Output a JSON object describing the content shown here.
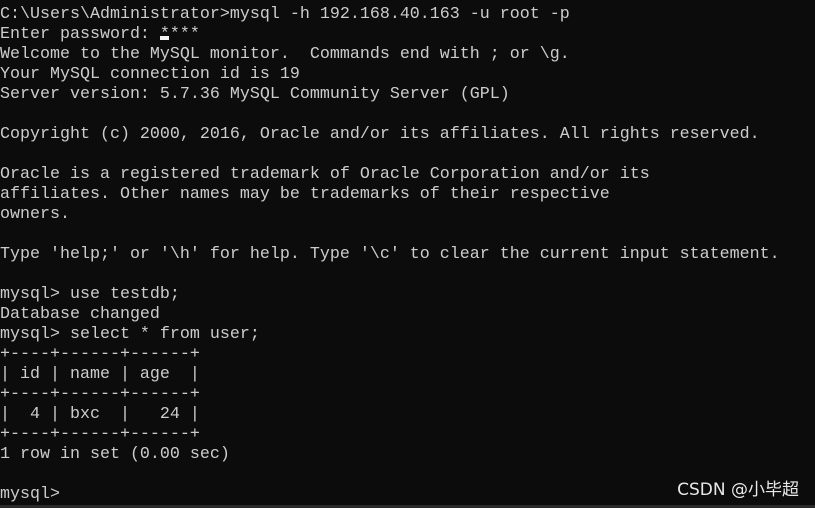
{
  "terminal": {
    "lines": [
      "C:\\Users\\Administrator>mysql -h 192.168.40.163 -u root -p",
      "Enter password: ****",
      "Welcome to the MySQL monitor.  Commands end with ; or \\g.",
      "Your MySQL connection id is 19",
      "Server version: 5.7.36 MySQL Community Server (GPL)",
      "",
      "Copyright (c) 2000, 2016, Oracle and/or its affiliates. All rights reserved.",
      "",
      "Oracle is a registered trademark of Oracle Corporation and/or its",
      "affiliates. Other names may be trademarks of their respective",
      "owners.",
      "",
      "Type 'help;' or '\\h' for help. Type '\\c' to clear the current input statement.",
      "",
      "mysql> use testdb;",
      "Database changed",
      "mysql> select * from user;",
      "+----+------+------+",
      "| id | name | age  |",
      "+----+------+------+",
      "|  4 | bxc  |   24 |",
      "+----+------+------+",
      "1 row in set (0.00 sec)",
      "",
      "mysql>"
    ]
  },
  "watermark": "CSDN @小毕超",
  "colors": {
    "background": "#0c0c0c",
    "text": "#cccccc"
  }
}
